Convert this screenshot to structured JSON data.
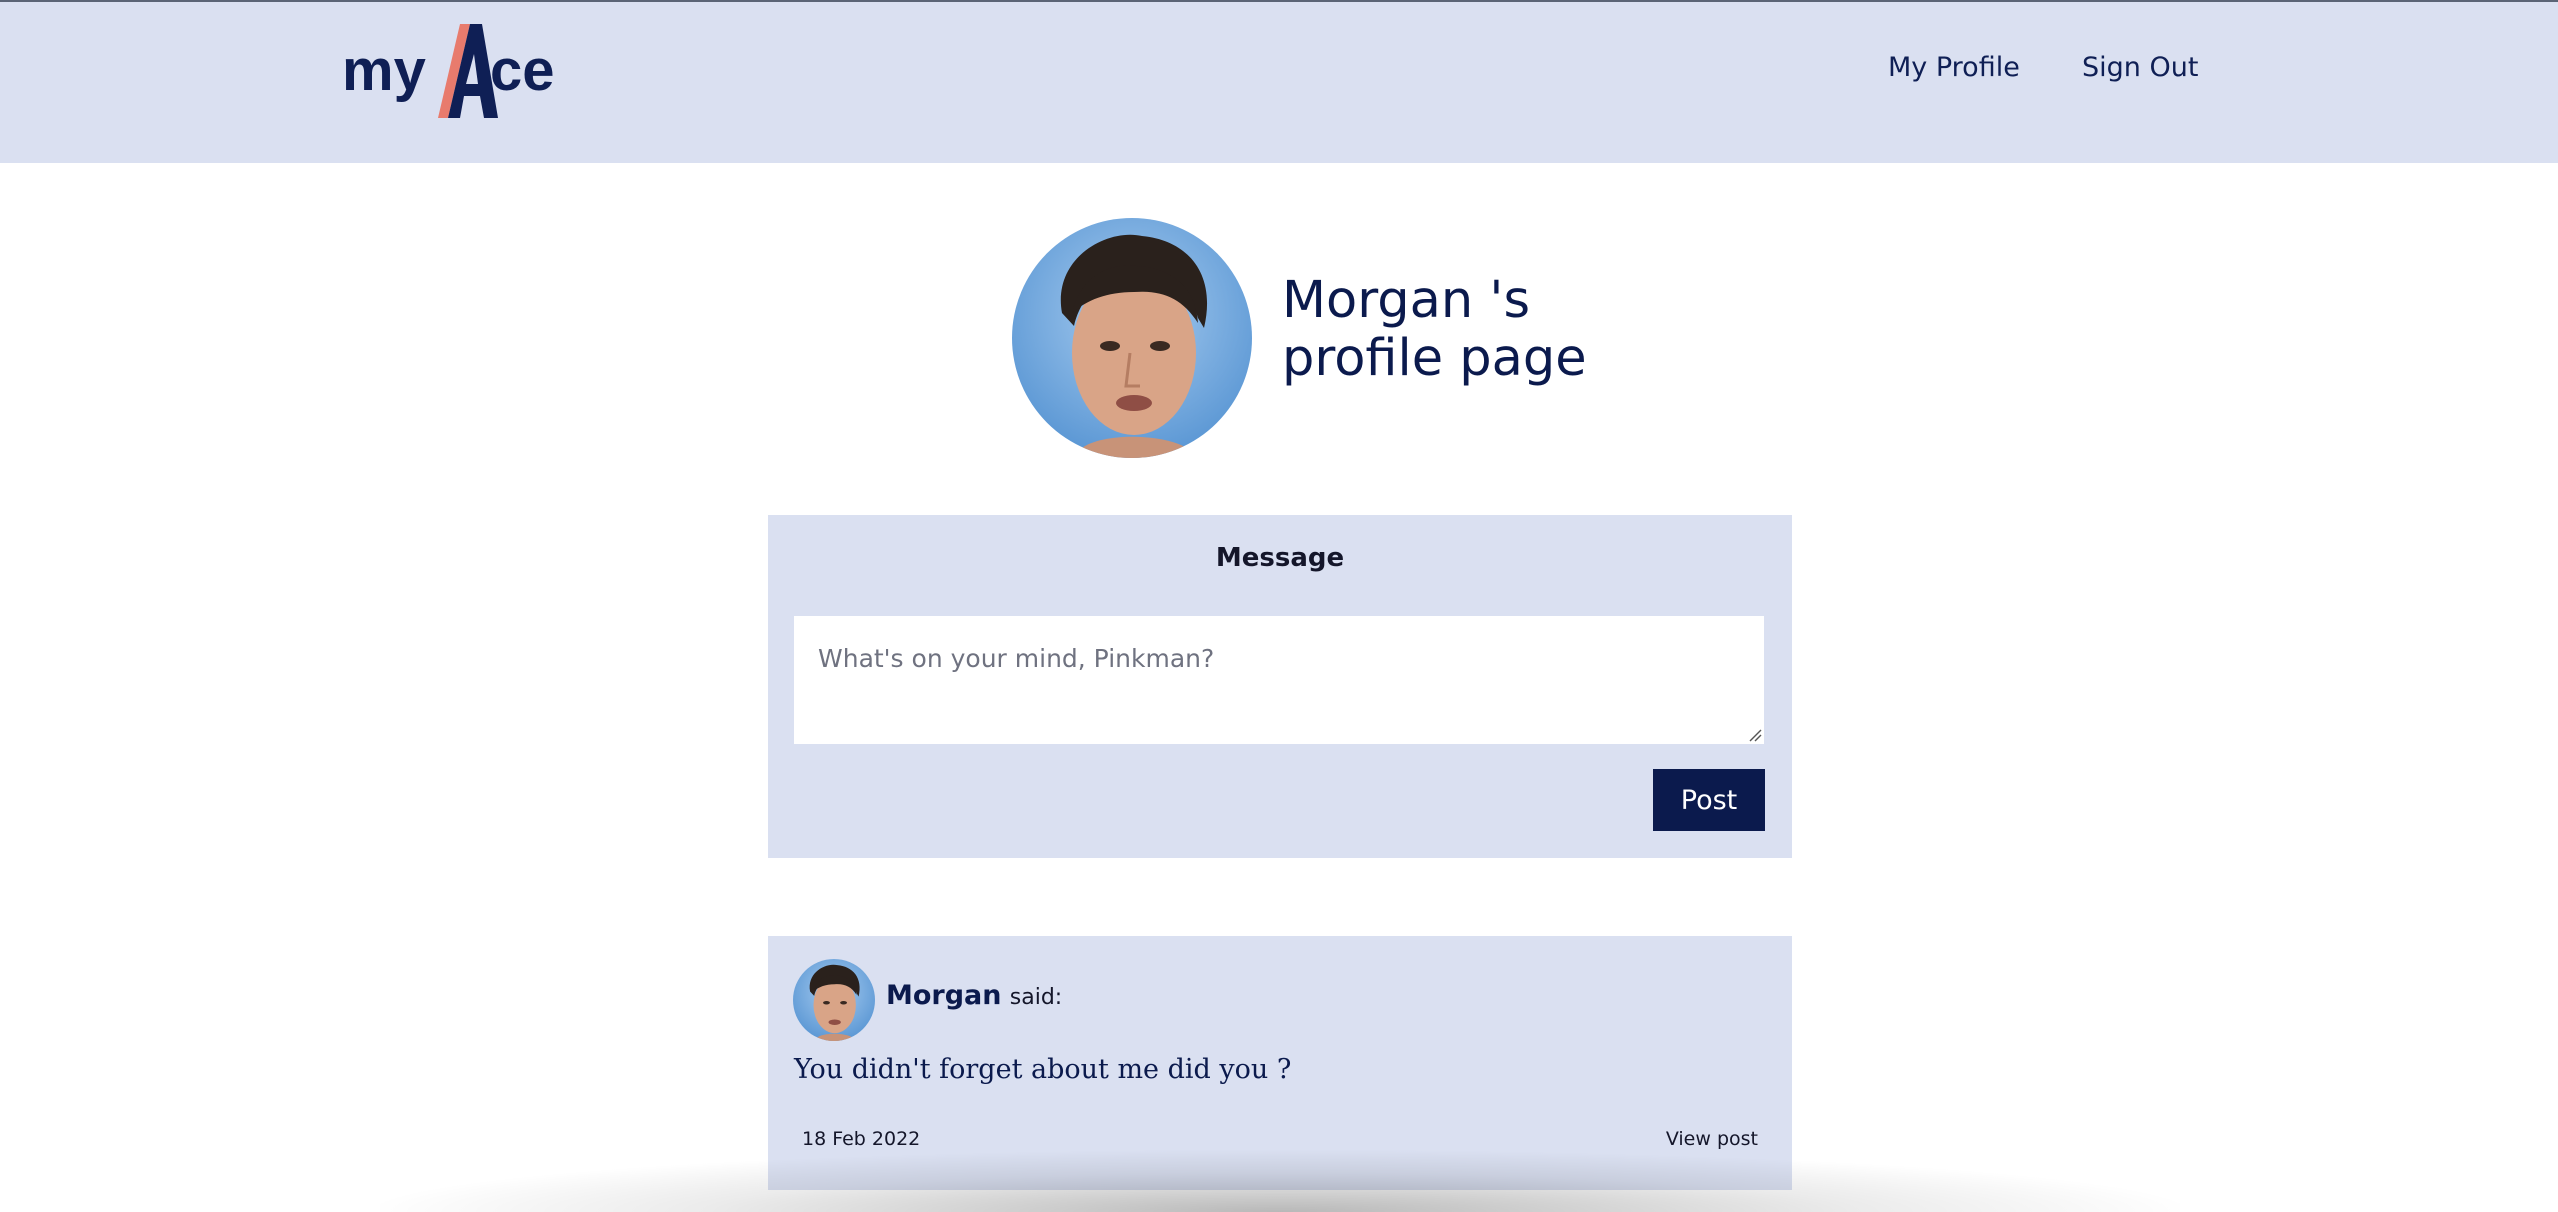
{
  "header": {
    "logo": {
      "text_left": "my",
      "text_mid": "A",
      "text_right": "ce"
    },
    "nav": {
      "my_profile": "My Profile",
      "sign_out": "Sign Out"
    }
  },
  "profile": {
    "title_line1": "Morgan 's",
    "title_line2": "profile page"
  },
  "message_form": {
    "title": "Message",
    "placeholder": "What's on your mind, Pinkman?",
    "post_label": "Post"
  },
  "posts": [
    {
      "author": "Morgan",
      "said": "said:",
      "body": "You didn't forget about me did you ?",
      "date": "18 Feb 2022",
      "view_label": "View post"
    }
  ],
  "colors": {
    "brand_navy": "#0b1a4d",
    "panel_bg": "#dae0f1",
    "logo_accent": "#e87b6d"
  }
}
